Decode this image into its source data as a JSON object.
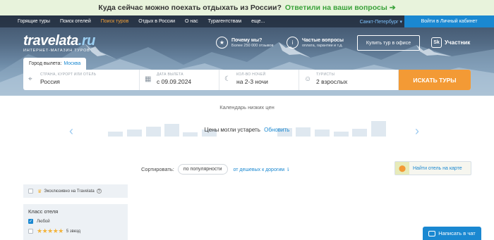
{
  "promo": {
    "text": "Куда сейчас можно поехать отдыхать из России?",
    "link": "Ответили на ваши вопросы"
  },
  "nav": {
    "items": [
      "Горящие туры",
      "Поиск отелей",
      "Поиск туров",
      "Отдых в России",
      "О нас",
      "Турагентствам",
      "еще..."
    ],
    "active_index": 2,
    "city": "Санкт-Петербург ▾",
    "login": "Войти в Личный кабинет"
  },
  "logo": {
    "main": "travelata",
    "domain": ".ru",
    "tagline": "ИНТЕРНЕТ-МАГАЗИН ТУРОВ"
  },
  "features": [
    {
      "icon": "star-badge-icon",
      "title": "Почему мы?",
      "subtitle": "Более 250 000 отзывов"
    },
    {
      "icon": "info-icon",
      "title": "Частые вопросы",
      "subtitle": "оплата, гарантии и т.д."
    }
  ],
  "office_button": "Купить тур в офисе",
  "member": "Участник",
  "departure": {
    "label": "Город вылета:",
    "city": "Москва"
  },
  "search": {
    "fields": [
      {
        "label": "СТРАНА, КУРОРТ ИЛИ ОТЕЛЬ",
        "value": "Россия"
      },
      {
        "label": "ДАТА ВЫЛЕТА",
        "value": "с 09.09.2024"
      },
      {
        "label": "КОЛ-ВО НОЧЕЙ",
        "value": "на 2-3 ночи"
      },
      {
        "label": "ТУРИСТЫ",
        "value": "2 взрослых"
      }
    ],
    "button": "ИСКАТЬ ТУРЫ"
  },
  "calendar": {
    "title": "Календарь низких цен",
    "stale_text": "Цены могли устареть",
    "refresh": "Обновить"
  },
  "sort": {
    "label": "Сортировать:",
    "active": "по популярности",
    "alt": "от дешевых к дорогим"
  },
  "map_button": "Найти отель на карте",
  "filters": {
    "exclusive": "Эксклюзивно на Travelata",
    "hotel_class_title": "Класс отеля",
    "any": "Любой",
    "five_stars": "5 звезд"
  },
  "chat": "Написать в чат",
  "colors": {
    "accent": "#1a88d1",
    "orange": "#f39a35",
    "green": "#3aa23a"
  }
}
